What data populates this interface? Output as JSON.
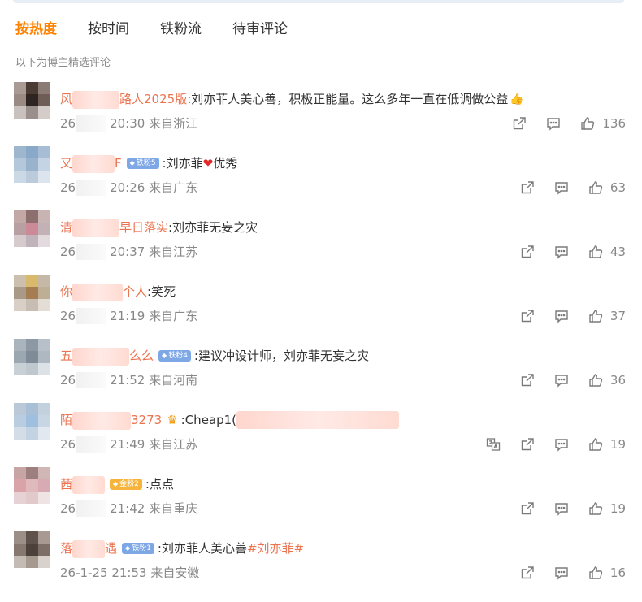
{
  "tabs": [
    {
      "label": "按热度",
      "active": true
    },
    {
      "label": "按时间",
      "active": false
    },
    {
      "label": "铁粉流",
      "active": false
    },
    {
      "label": "待审评论",
      "active": false
    }
  ],
  "subtitle": "以下为博主精选评论",
  "colors": {
    "accent": "#ff8200",
    "username": "#eb7350",
    "meta": "#888888"
  },
  "comments": [
    {
      "name_start": "风",
      "name_end": "路人2025版",
      "badge": "",
      "text": ":刘亦菲人美心善，积极正能量。这么多年一直在低调做公益",
      "emoji": "thumbs-up",
      "date_start": "26",
      "time": "20:30",
      "location": "来自浙江",
      "likes": "136",
      "avatar": [
        "#a99b94",
        "#4a3b35",
        "#8a7b74",
        "#9a8a84",
        "#2e2523",
        "#6d5d56",
        "#c9c1bd",
        "#9a8f8a",
        "#d3ccc8"
      ]
    },
    {
      "name_start": "又",
      "name_end": "F",
      "badge": "铁粉5",
      "text": ":刘亦菲",
      "heart": "❤",
      "text_after": "优秀",
      "date_start": "26",
      "time": "20:26",
      "location": "来自广东",
      "likes": "63",
      "avatar": [
        "#9fb6cf",
        "#8aa9c9",
        "#a7bdd6",
        "#b4c8dc",
        "#9ab3cd",
        "#c4d4e4",
        "#cbd8e6",
        "#bccbdc",
        "#dce5ee"
      ]
    },
    {
      "name_start": "清",
      "name_end": "早日落实",
      "badge": "",
      "text": ":刘亦菲无妄之灾",
      "date_start": "26",
      "time": "20:37",
      "location": "来自江苏",
      "likes": "43",
      "avatar": [
        "#c3a9a6",
        "#8d6f70",
        "#c7b4b3",
        "#b8a0a2",
        "#cc8a98",
        "#c2b2b6",
        "#d6cacc",
        "#c0b4ba",
        "#e3dadd"
      ]
    },
    {
      "name_start": "你",
      "name_end": "个人",
      "badge": "",
      "text": ":笑死",
      "date_start": "26",
      "time": "21:19",
      "location": "来自广东",
      "likes": "37",
      "avatar": [
        "#cbbfae",
        "#d9b96b",
        "#c5b8a6",
        "#a89a86",
        "#a67c52",
        "#bfae96",
        "#d8d0c6",
        "#c7bdb2",
        "#e3ddd6"
      ]
    },
    {
      "name_start": "五",
      "name_end": "么么",
      "badge": "铁粉4",
      "text": ":建议冲设计师，刘亦菲无妄之灾",
      "date_start": "26",
      "time": "21:52",
      "location": "来自河南",
      "likes": "36",
      "avatar": [
        "#aab4bc",
        "#8c99a4",
        "#b7c0c8",
        "#9ba8b2",
        "#7f8c98",
        "#aeb8c1",
        "#c8d0d6",
        "#c0c8cf",
        "#dde2e6"
      ]
    },
    {
      "name_start": "陌",
      "name_end": "3273",
      "badge": "",
      "crown": "♛",
      "text": ":Cheap1(",
      "date_start": "26",
      "time": "21:49",
      "location": "来自江苏",
      "likes": "19",
      "translate": true,
      "avatar": [
        "#bac8d8",
        "#a8bfd6",
        "#c3d0de",
        "#b9cde0",
        "#9fbfdf",
        "#c8d6e4",
        "#d2dde8",
        "#c4d3e2",
        "#e1e8ef"
      ]
    },
    {
      "name_start": "茜",
      "name_end": "",
      "badge": "金粉2",
      "badge_gold": true,
      "text": ":点点",
      "date_start": "26",
      "time": "21:42",
      "location": "来自重庆",
      "likes": "19",
      "avatar": [
        "#c7a5a5",
        "#9e7f7f",
        "#d1b6b6",
        "#d9a3a8",
        "#e0b9bd",
        "#d8aab4",
        "#e6d2d4",
        "#e2c9cc",
        "#f0e3e4"
      ]
    },
    {
      "name_start": "落",
      "name_end": "遇",
      "badge": "铁粉1",
      "text": ":刘亦菲人美心善",
      "tag": "#刘亦菲#",
      "date_start": "26-1-25",
      "time": "21:53",
      "location": "来自安徽",
      "likes": "16",
      "full_date": true,
      "avatar": [
        "#9c8f88",
        "#5f524c",
        "#a89a92",
        "#86786f",
        "#4d413b",
        "#7d6f67",
        "#c4bbb5",
        "#a59990",
        "#d8d1cc"
      ]
    }
  ]
}
